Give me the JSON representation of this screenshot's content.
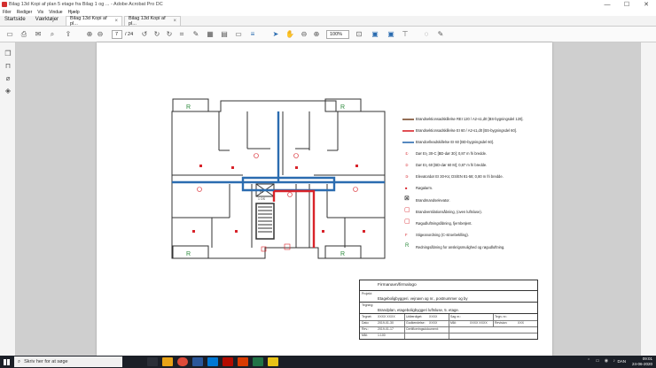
{
  "window": {
    "title": "Bilag 13d Kopi af plan 5 etage fra Bilag 1 og ... - Adobe Acrobat Pro DC",
    "minimize": "—",
    "maximize": "☐",
    "close": "✕"
  },
  "menu": [
    "Filer",
    "Rediger",
    "Vis",
    "Vindue",
    "Hjælp"
  ],
  "nav_tabs": [
    "Startside",
    "Værktøjer"
  ],
  "doc_tabs": [
    {
      "label": "Bilag 13d Kopi af pl...",
      "close": "×"
    },
    {
      "label": "Bilag 13d Kopi af pl...",
      "close": "×"
    }
  ],
  "toolbar": {
    "page_current": "7",
    "page_total": "/ 24",
    "zoom": "100%"
  },
  "legend": [
    {
      "text": "Brandsektionsadskillelse REI 120 / A2-s1,d0 [BS-bygningsdel 120].",
      "color": "#7a4a2c"
    },
    {
      "text": "Brandsektionsadskillelse EI 60 / A2-s1,d0 [BS-bygningsdel 60].",
      "color": "#d8232a"
    },
    {
      "text": "Brandcelleadskillelse EI 60 [BD-bygningsdel 60].",
      "color": "#2b6cb0"
    },
    {
      "text": "Dør EI₂ 30-C [BD-dør 30]; 0,87 m fri bredde.",
      "sym": "①"
    },
    {
      "text": "Dør EI₂ 60 [BD-dør 60 M]; 0,87 m fri bredde.",
      "sym": "②"
    },
    {
      "text": "Elevatordør EI 30-Ks; DS/EN 81-58; 0,80 m fri bredde.",
      "sym": "③"
    },
    {
      "text": "Røgalarm.",
      "sym": "■"
    },
    {
      "text": "Brandmandselevator.",
      "sym": "⊠"
    },
    {
      "text": "Brandventilationsåbning, (oven luftsluse).",
      "sym": "▢"
    },
    {
      "text": "Røgudluftningsåbning, fjernbetjent.",
      "sym": "▢"
    },
    {
      "text": "Stigeanordning (C-stroebeklling).",
      "sym": "F"
    },
    {
      "text": "Redningsåbning for anskrigsmulighed og røgudluftning.",
      "sym": "R"
    }
  ],
  "title_block": {
    "firm": "Firmanavn/firmalogo",
    "label_project": "Projekt:",
    "project": "Etageboligbyggeri, vejnavn og nr., postnummer og by",
    "label_drawing": "Tegning:",
    "drawing": "Brandplan, etageboligbyggeri luftsluse, 5. etage.",
    "rows": [
      [
        "Tegnet:",
        "XXXX XXXX",
        "Udfærdiget:",
        "XXXX",
        "Sag nr.:",
        "",
        "Tegn. nr.:",
        ""
      ],
      [
        "Dato:",
        "2019-01-30",
        "Godkendelse:",
        "XXXX",
        "Mål:",
        "XXXX XXXX",
        "Revision:",
        "XXX"
      ],
      [
        "Rev.:",
        "2019-01-17",
        "Certificeringsdokument:",
        "",
        "",
        "",
        "",
        ""
      ],
      [
        "Mål:",
        "1:100",
        "",
        "",
        "",
        "",
        "",
        ""
      ]
    ]
  },
  "plan_marks": {
    "rescue": "R",
    "elevator_label": "FL",
    "lift": "1 OS"
  },
  "taskbar": {
    "search_placeholder": "Skriv her for at søge",
    "lang": "DAN",
    "time": "09:01",
    "date": "24-06-2020"
  }
}
